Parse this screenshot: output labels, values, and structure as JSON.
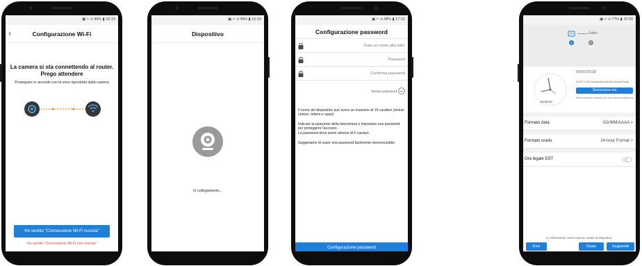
{
  "status": {
    "phone1": "▣ ≈ .ıl 49% ▮ 16:19",
    "phone2": "▣ ≈ .ıl 49% ▮ 16:19",
    "phone3": "▣ ≈ .ıl 48% ▮ 17:12",
    "phone4": "▣ ≈ .ıl 77% ▮ 15:09"
  },
  "screen1": {
    "title": "Configurazione Wi-Fi",
    "heading_line1": "La camera si sta connettendo al router.",
    "heading_line2": "Prego attendere",
    "subtext": "Proseguire in accordo con la voce riprodotta dalla camera",
    "primary_button": "Ho sentito \"Connessione Wi-Fi riuscita\"",
    "secondary_link": "Ho sentito \"Connessione Wi-Fi non riuscita\""
  },
  "screen2": {
    "title": "Dispositivo",
    "loading_text": "In collegamento..."
  },
  "screen3": {
    "title": "Configurazione password",
    "fields": [
      {
        "placeholder": "Dare un nome alla telec"
      },
      {
        "placeholder": "Password"
      },
      {
        "placeholder": "Conferma password"
      }
    ],
    "show_password": "Mostra password",
    "info1": "Il nome del dispositivo può avere un massimo di 16 caratteri (inclusi numeri, lettere e spazi)",
    "info2": "Indicare la posizione della telecamera e impostare una password per proteggere l'accesso.",
    "info2b": "La password deve avere almeno di 6 carateri.",
    "info3": "Suggeriamo di usare una password facilmente memorizzabile.",
    "submit": "Configurazione password"
  },
  "screen4": {
    "step_label": "Fatto",
    "step1": "1",
    "step2": "2",
    "date": "05/02/2018",
    "timezone": "(GMT+1:00) Amsterdam,Berlino,Roma,Parigi",
    "sync_button": "Sincronizza ora",
    "sync_note": "Sincronizza la camera con l'ora dello smartphone",
    "clock_time": "15:09:32",
    "rows": [
      {
        "label": "Formato data",
        "value": "GG/MM/AAAA  >"
      },
      {
        "label": "Formato orario",
        "value": "24-hour Format  >"
      },
      {
        "label": "Ora legale DST",
        "value": ""
      }
    ],
    "footer_note": "Le informazioni orarie saranno inviate al dispositivo.",
    "btn_exit": "Esci",
    "btn_later": "Dopo",
    "btn_next": "Seguente"
  },
  "colors": {
    "accent": "#1f7fd9",
    "error": "#e8453c",
    "dark_icon": "#33363a"
  }
}
